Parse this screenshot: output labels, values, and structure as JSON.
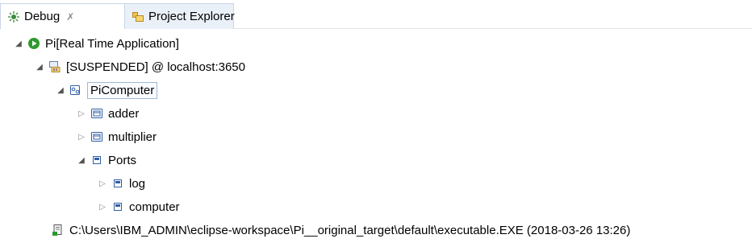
{
  "tabs": [
    {
      "label": "Debug",
      "close_glyph": "✗",
      "icon": "debug-icon"
    },
    {
      "label": "Project Explorer",
      "icon": "project-explorer-icon"
    }
  ],
  "tree": {
    "app": {
      "label": "Pi[Real Time Application]",
      "icon": "run-icon"
    },
    "target": {
      "label": "[SUSPENDED] @ localhost:3650",
      "icon": "suspended-target-icon"
    },
    "component": {
      "label": "PiComputer",
      "icon": "component-icon"
    },
    "children": [
      {
        "label": "adder",
        "icon": "instance-icon"
      },
      {
        "label": "multiplier",
        "icon": "instance-icon"
      },
      {
        "label": "Ports",
        "icon": "port-icon"
      },
      {
        "label": "log",
        "icon": "port-icon"
      },
      {
        "label": "computer",
        "icon": "port-icon"
      }
    ],
    "process": {
      "label": "C:\\Users\\IBM_ADMIN\\eclipse-workspace\\Pi__original_target\\default\\executable.EXE (2018-03-26 13:26)",
      "icon": "process-icon"
    }
  },
  "colors": {
    "run_green": "#2e9a2e",
    "tab_border": "#c9d6e6"
  }
}
